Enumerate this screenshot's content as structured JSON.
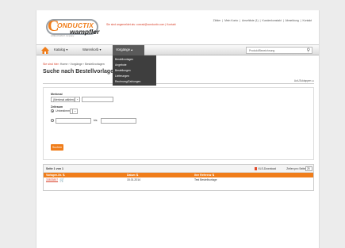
{
  "header": {
    "logo_text": "ONDUCTIX",
    "logo_c": "C",
    "logo_sub": "wampfler",
    "logo_tag": "a DELACHAUX company",
    "contact": "Sie sind angemeldet als: conrad@conductix.com | Kontakt",
    "topnav": [
      "Zähler",
      "Mein Konto",
      "Ansehliste (1)",
      "Kundenkonstakt",
      "Abmeldung",
      "Kontakt"
    ]
  },
  "nav": {
    "items": [
      "Katalog ▾",
      "Warenkorb ▾"
    ],
    "active": "Vorgänge ▴",
    "search_placeholder": "Produkt/Bezeichnung"
  },
  "dropdown": {
    "items": [
      "Bestellvorlagen",
      "Angebote",
      "Bestellungen",
      "Lieferungen",
      "Rechnung/Zahlungen"
    ]
  },
  "breadcrumb": {
    "back": "Sie sind hier:",
    "path": "Home › Vorgänge › Bestellvorlagen"
  },
  "page": {
    "title": "Suche nach Bestellvorlagen",
    "collapse": "Auf-/Zuklappen"
  },
  "form": {
    "merkmal_label": "Merkmal",
    "merkmal_value": "(Merkmal wählen)",
    "zeitraum_label": "Zeitraum",
    "zeitraum_value": "Unbestimmt",
    "bis": "bis",
    "search_button": "Suchen"
  },
  "results": {
    "page_info": "Seite 1 von 1",
    "xls": "XLS-Download",
    "per_page_label": "Zeilen pro Seite",
    "per_page_value": "25",
    "headers": [
      "Vorlagen-Nr. ⇅",
      "Datum ⇅",
      "Ihre Referenz ⇅"
    ],
    "rows": [
      {
        "nr": "33833857",
        "datum": "15.01.2014",
        "referenz": "Test Bestellvorlage"
      }
    ]
  },
  "colors": {
    "accent": "#f07d1a",
    "link": "#d9422b"
  }
}
